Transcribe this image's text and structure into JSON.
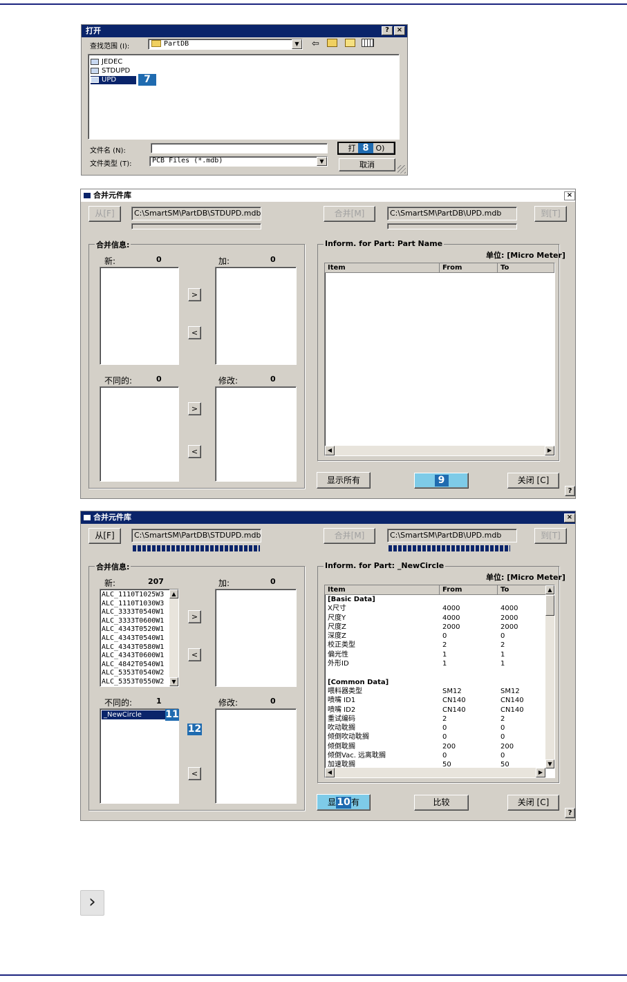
{
  "open_dialog": {
    "title": "打开",
    "help_btn": "?",
    "close_btn": "×",
    "look_in_label": "查找范围 (I):",
    "look_in_value": "PartDB",
    "folders": [
      "JEDEC",
      "STDUPD",
      "UPD"
    ],
    "filename_label": "文件名 (N):",
    "filename_value": "",
    "filetype_label": "文件类型 (T):",
    "filetype_value": "PCB Files (*.mdb)",
    "open_btn_prefix": "打",
    "open_btn_suffix": "O)",
    "cancel_btn": "取消",
    "markers": [
      "7",
      "8"
    ]
  },
  "merge1": {
    "title": "合并元件库",
    "close_btn": "×",
    "from_btn": "从[F]",
    "src_path": "C:\\SmartSM\\PartDB\\STDUPD.mdb",
    "merge_btn": "合并[M]",
    "dst_path": "C:\\SmartSM\\PartDB\\UPD.mdb",
    "to_btn": "到[T]",
    "merge_info_label": "合并信息:",
    "new_label": "新:",
    "new_count": "0",
    "add_label": "加:",
    "add_count": "0",
    "diff_label": "不同的:",
    "diff_count": "0",
    "modify_label": "修改:",
    "modify_count": "0",
    "arrow_right": ">",
    "arrow_left": "<",
    "inform_label": "Inform. for Part: Part Name",
    "unit_label": "单位: [Micro Meter]",
    "col_item": "Item",
    "col_from": "From",
    "col_to": "To",
    "show_all_btn": "显示所有",
    "marker": "9",
    "close_text_btn": "关闭 [C]",
    "help": "?"
  },
  "merge2": {
    "title": "合并元件库",
    "close_btn": "×",
    "from_btn": "从[F]",
    "src_path": "C:\\SmartSM\\PartDB\\STDUPD.mdb",
    "merge_btn": "合并[M]",
    "dst_path": "C:\\SmartSM\\PartDB\\UPD.mdb",
    "to_btn": "到[T]",
    "merge_info_label": "合并信息:",
    "new_label": "新:",
    "new_count": "207",
    "new_items": [
      "ALC_1110T1025W3",
      "ALC_1110T1030W3",
      "ALC_3333T0540W1",
      "ALC_3333T0600W1",
      "ALC_4343T0520W1",
      "ALC_4343T0540W1",
      "ALC_4343T0580W1",
      "ALC_4343T0600W1",
      "ALC_4842T0540W1",
      "ALC_5353T0540W2",
      "ALC_5353T0550W2"
    ],
    "add_label": "加:",
    "add_count": "0",
    "diff_label": "不同的:",
    "diff_count": "1",
    "diff_items": [
      "_NewCircle"
    ],
    "modify_label": "修改:",
    "modify_count": "0",
    "arrow_right": ">",
    "arrow_left": "<",
    "inform_label": "Inform. for Part: _NewCircle",
    "unit_label": "单位: [Micro Meter]",
    "col_item": "Item",
    "col_from": "From",
    "col_to": "To",
    "rows": [
      [
        "[Basic Data]",
        "",
        ""
      ],
      [
        "X尺寸",
        "4000",
        "4000"
      ],
      [
        "尺度Y",
        "4000",
        "2000"
      ],
      [
        "尺度Z",
        "2000",
        "2000"
      ],
      [
        "深度Z",
        "0",
        "0"
      ],
      [
        "校正类型",
        "2",
        "2"
      ],
      [
        "偏光性",
        "1",
        "1"
      ],
      [
        "外形ID",
        "1",
        "1"
      ],
      [
        "",
        "",
        ""
      ],
      [
        "[Common Data]",
        "",
        ""
      ],
      [
        "喂料器类型",
        "SM12",
        "SM12"
      ],
      [
        "喷嘴 ID1",
        "CN140",
        "CN140"
      ],
      [
        "喷嘴 ID2",
        "CN140",
        "CN140"
      ],
      [
        "重试编码",
        "2",
        "2"
      ],
      [
        "吹动耽搁",
        "0",
        "0"
      ],
      [
        "倾倒吹动耽搁",
        "0",
        "0"
      ],
      [
        "倾倒耽搁",
        "200",
        "200"
      ],
      [
        "倾倒Vac. 远离耽搁",
        "0",
        "0"
      ],
      [
        "加速耽搁",
        "50",
        "50"
      ]
    ],
    "show_all_prefix": "显",
    "show_all_suffix": "有",
    "compare_btn": "比较",
    "close_text_btn": "关闭 [C]",
    "help": "?",
    "markers": [
      "10",
      "11",
      "12"
    ]
  },
  "icon_note": {
    "icon": "chevron-right-icon",
    "glyph": "›"
  }
}
